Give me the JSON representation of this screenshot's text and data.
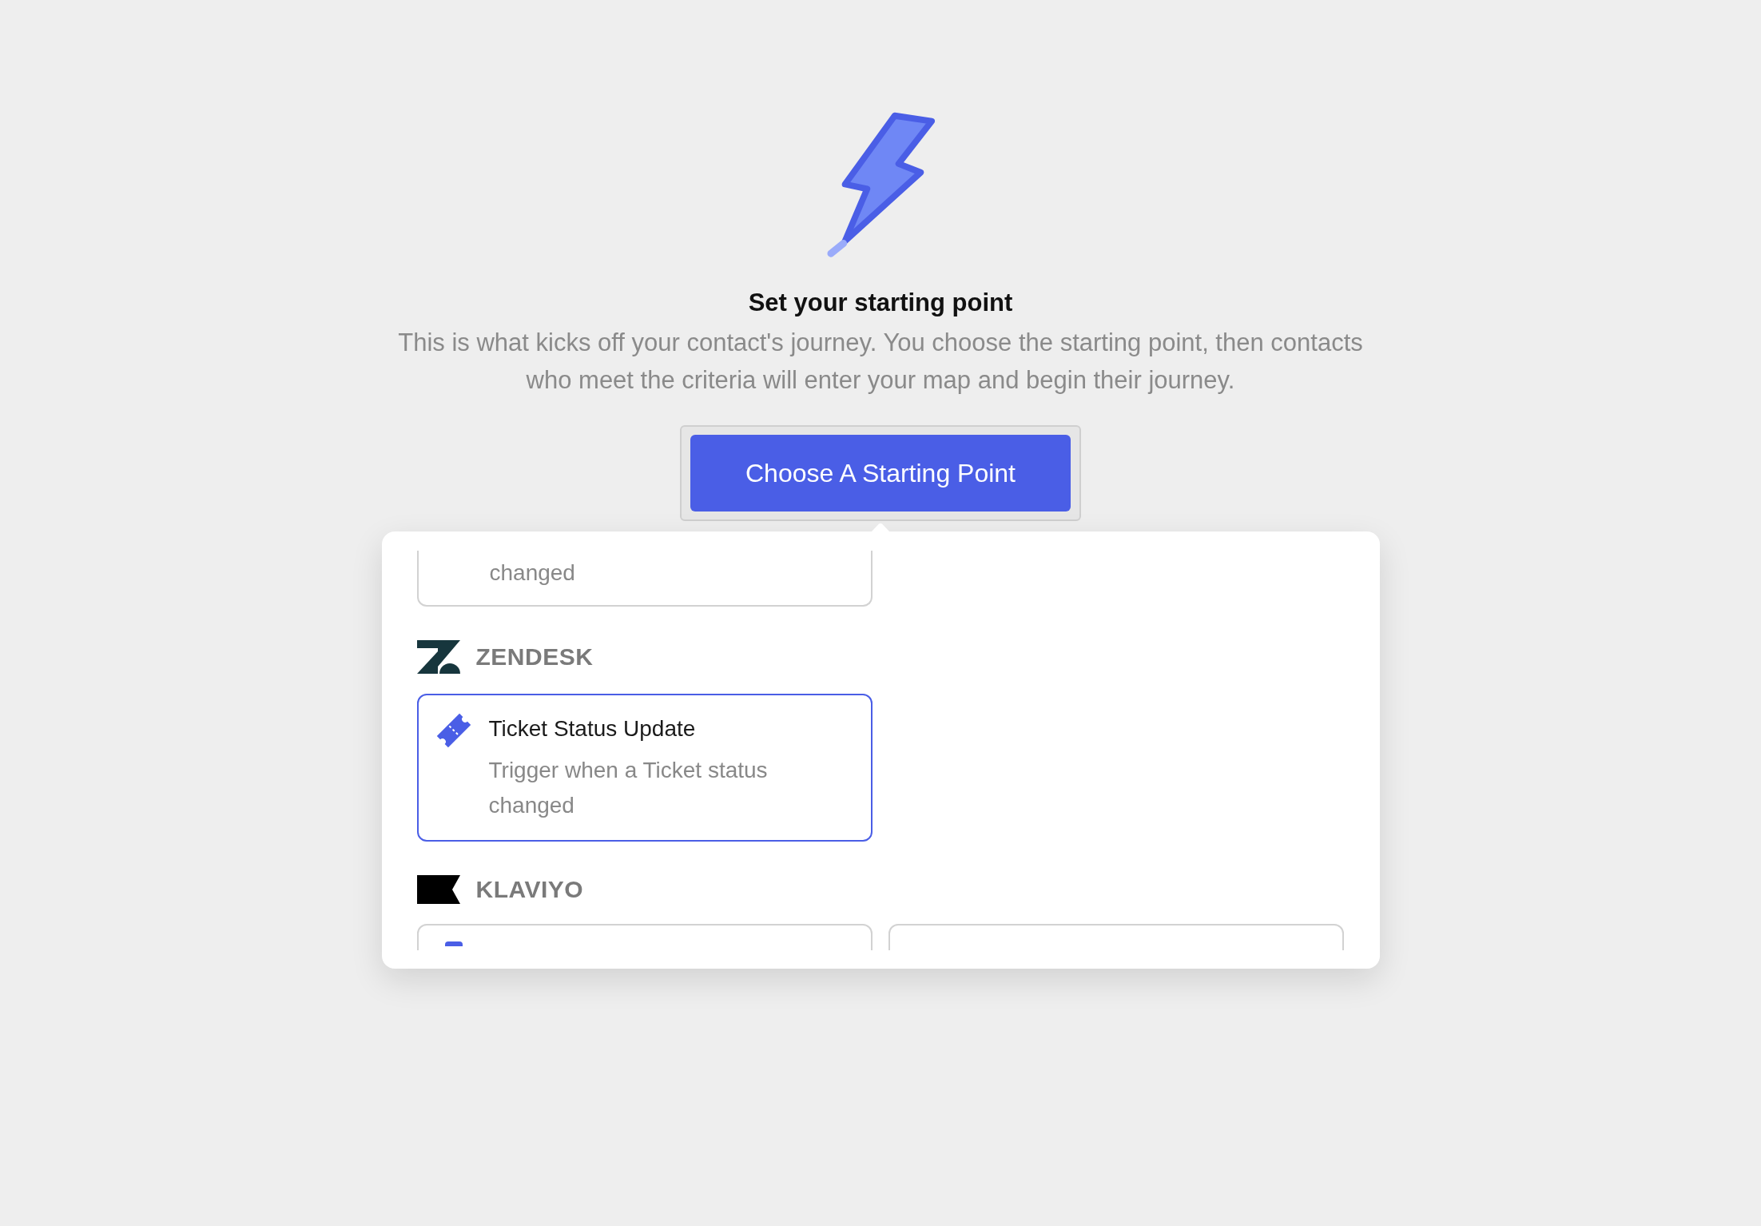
{
  "heading": {
    "title": "Set your starting point",
    "description": "This is what kicks off your contact's journey. You choose the starting point, then contacts who meet the criteria will enter your map and begin their journey."
  },
  "button": {
    "label": "Choose A Starting Point",
    "expanded": true
  },
  "dropdown": {
    "partial_card": {
      "description": "changed"
    },
    "sections": [
      {
        "name": "ZENDESK",
        "kind": "zendesk",
        "cards": [
          {
            "kind": "ticket",
            "title": "Ticket Status Update",
            "description": "Trigger when a Ticket status changed",
            "selected": true
          }
        ]
      },
      {
        "name": "KLAVIYO",
        "kind": "klaviyo",
        "cards": [
          {
            "kind": "event",
            "selected": false
          },
          {
            "kind": "plain",
            "selected": false
          }
        ]
      }
    ]
  }
}
